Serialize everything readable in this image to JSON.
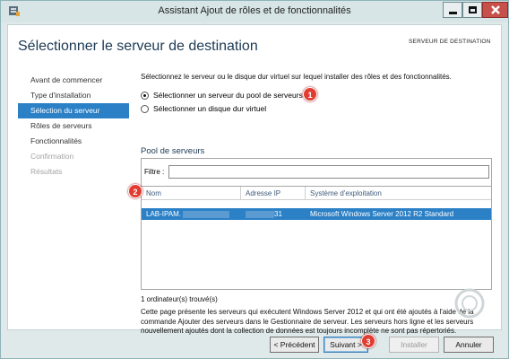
{
  "window": {
    "title": "Assistant Ajout de rôles et de fonctionnalités",
    "colors": {
      "accent": "#2b80c6",
      "title": "#1c3a54",
      "callout": "#e23c31"
    }
  },
  "header": {
    "page_title": "Sélectionner le serveur de destination",
    "server_label": "SERVEUR DE DESTINATION"
  },
  "nav": {
    "items": [
      {
        "label": "Avant de commencer",
        "state": "normal"
      },
      {
        "label": "Type d'installation",
        "state": "normal"
      },
      {
        "label": "Sélection du serveur",
        "state": "active"
      },
      {
        "label": "Rôles de serveurs",
        "state": "normal"
      },
      {
        "label": "Fonctionnalités",
        "state": "normal"
      },
      {
        "label": "Confirmation",
        "state": "disabled"
      },
      {
        "label": "Résultats",
        "state": "disabled"
      }
    ]
  },
  "content": {
    "instruction": "Sélectionnez le serveur ou le disque dur virtuel sur lequel installer des rôles et des fonctionnalités.",
    "radio_pool": "Sélectionner un serveur du pool de serveurs",
    "radio_vhd": "Sélectionner un disque dur virtuel",
    "pool_title": "Pool de serveurs",
    "filter_label": "Filtre :",
    "filter_value": "",
    "columns": [
      "Nom",
      "Adresse IP",
      "Système d'exploitation"
    ],
    "rows": [
      {
        "name": "LAB-IPAM.",
        "ip": "31",
        "os": "Microsoft Windows Server 2012 R2 Standard"
      }
    ],
    "found_count": "1 ordinateur(s) trouvé(s)",
    "description": "Cette page présente les serveurs qui exécutent Windows Server 2012 et qui ont été ajoutés à l'aide de la commande Ajouter des serveurs dans le Gestionnaire de serveur. Les serveurs hors ligne et les serveurs nouvellement ajoutés dont la collection de données est toujours incomplète ne sont pas répertoriés."
  },
  "buttons": {
    "prev": "< Précédent",
    "next": "Suivant >",
    "install": "Installer",
    "cancel": "Annuler"
  },
  "callouts": [
    "1",
    "2",
    "3"
  ]
}
